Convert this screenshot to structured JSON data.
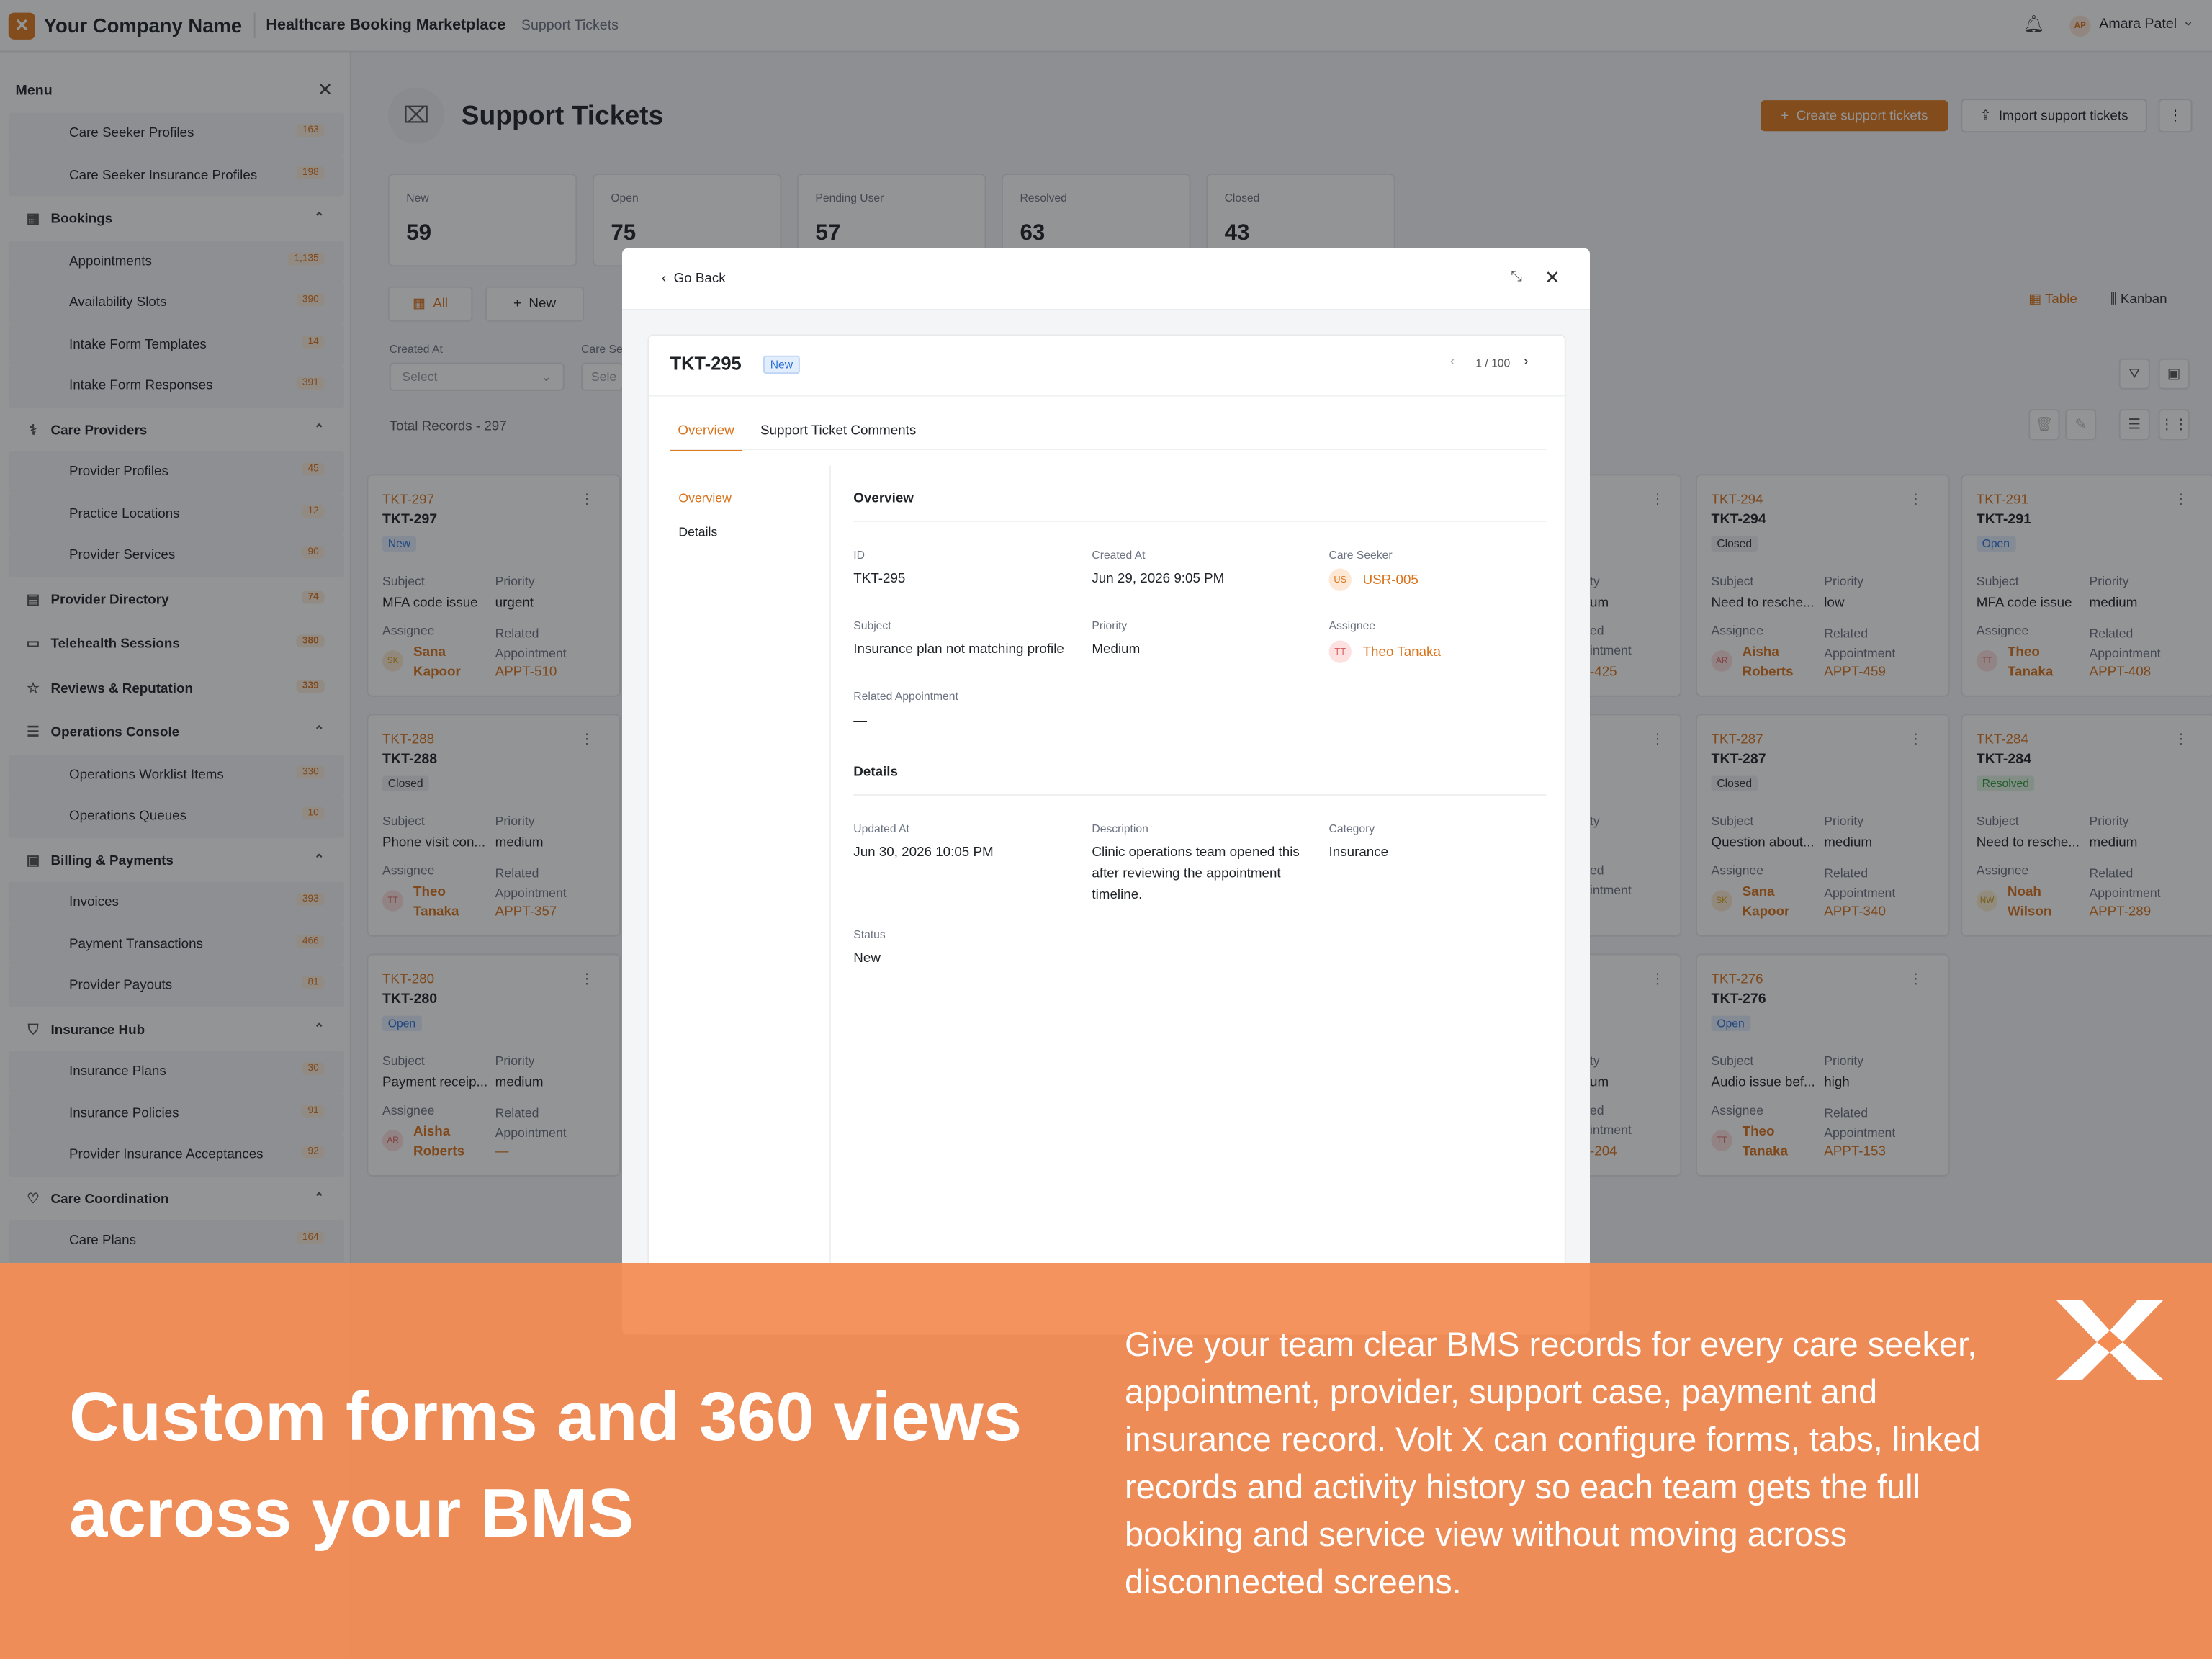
{
  "header": {
    "logo_glyph": "✕",
    "company": "Your Company Name",
    "app_name": "Healthcare Booking Marketplace",
    "breadcrumb": "Support Tickets",
    "user_initials": "AP",
    "user_name": "Amara Patel"
  },
  "sidebar": {
    "title": "Menu",
    "items": [
      {
        "label": "Care Seeker Profiles",
        "badge": "163",
        "type": "child"
      },
      {
        "label": "Care Seeker Insurance Profiles",
        "badge": "198",
        "type": "child"
      },
      {
        "label": "Bookings",
        "type": "parent",
        "icon": "calendar-icon",
        "glyph": "▦"
      },
      {
        "label": "Appointments",
        "badge": "1,135",
        "type": "child"
      },
      {
        "label": "Availability Slots",
        "badge": "390",
        "type": "child"
      },
      {
        "label": "Intake Form Templates",
        "badge": "14",
        "type": "child"
      },
      {
        "label": "Intake Form Responses",
        "badge": "391",
        "type": "child"
      },
      {
        "label": "Care Providers",
        "type": "parent",
        "icon": "stethoscope-icon",
        "glyph": "⚕"
      },
      {
        "label": "Provider Profiles",
        "badge": "45",
        "type": "child"
      },
      {
        "label": "Practice Locations",
        "badge": "12",
        "type": "child"
      },
      {
        "label": "Provider Services",
        "badge": "90",
        "type": "child"
      },
      {
        "label": "Provider Directory",
        "badge": "74",
        "type": "leaf",
        "icon": "book-icon",
        "glyph": "▤"
      },
      {
        "label": "Telehealth Sessions",
        "badge": "380",
        "type": "leaf",
        "icon": "video-icon",
        "glyph": "▭"
      },
      {
        "label": "Reviews & Reputation",
        "badge": "339",
        "type": "leaf",
        "icon": "star-icon",
        "glyph": "☆"
      },
      {
        "label": "Operations Console",
        "type": "parent",
        "icon": "sliders-icon",
        "glyph": "☰"
      },
      {
        "label": "Operations Worklist Items",
        "badge": "330",
        "type": "child"
      },
      {
        "label": "Operations Queues",
        "badge": "10",
        "type": "child"
      },
      {
        "label": "Billing & Payments",
        "type": "parent",
        "icon": "receipt-icon",
        "glyph": "▣"
      },
      {
        "label": "Invoices",
        "badge": "393",
        "type": "child"
      },
      {
        "label": "Payment Transactions",
        "badge": "466",
        "type": "child"
      },
      {
        "label": "Provider Payouts",
        "badge": "81",
        "type": "child"
      },
      {
        "label": "Insurance Hub",
        "type": "parent",
        "icon": "shield-icon",
        "glyph": "⛉"
      },
      {
        "label": "Insurance Plans",
        "badge": "30",
        "type": "child"
      },
      {
        "label": "Insurance Policies",
        "badge": "91",
        "type": "child"
      },
      {
        "label": "Provider Insurance Acceptances",
        "badge": "92",
        "type": "child"
      },
      {
        "label": "Care Coordination",
        "type": "parent",
        "icon": "heart-icon",
        "glyph": "♡"
      },
      {
        "label": "Care Plans",
        "badge": "164",
        "type": "child"
      }
    ]
  },
  "page": {
    "title": "Support Tickets",
    "create_label": "Create support tickets",
    "import_label": "Import support tickets",
    "stats": [
      {
        "label": "New",
        "value": "59"
      },
      {
        "label": "Open",
        "value": "75"
      },
      {
        "label": "Pending User",
        "value": "57"
      },
      {
        "label": "Resolved",
        "value": "63"
      },
      {
        "label": "Closed",
        "value": "43"
      }
    ],
    "tab_all": "All",
    "tab_new": "New",
    "view_table": "Table",
    "view_kanban": "Kanban",
    "filter_label": "Created At",
    "filter_placeholder": "Select",
    "filter2_label": "Care Se",
    "filter2_placeholder": "Sele",
    "total_records": "Total Records - 297",
    "field_subject": "Subject",
    "field_priority": "Priority",
    "field_assignee": "Assignee",
    "field_related": "Related Appointment"
  },
  "cards": [
    {
      "id": "TKT-297",
      "title": "TKT-297",
      "status": "New",
      "subject": "MFA code issue",
      "priority": "urgent",
      "initials": "SK",
      "assignee": "Sana Kapoor",
      "related": "APPT-510"
    },
    {
      "id": "TKT-288",
      "title": "TKT-288",
      "status": "Closed",
      "subject": "Phone visit con...",
      "priority": "medium",
      "initials": "TT",
      "assignee": "Theo Tanaka",
      "related": "APPT-357"
    },
    {
      "id": "TKT-280",
      "title": "TKT-280",
      "status": "Open",
      "subject": "Payment receip...",
      "priority": "medium",
      "initials": "AR",
      "assignee": "Aisha Roberts",
      "related": "—"
    },
    {
      "id": "TKT-294",
      "title": "TKT-294",
      "status": "Closed",
      "subject": "Need to resche...",
      "priority": "low",
      "initials": "AR",
      "assignee": "Aisha Roberts",
      "related": "APPT-459"
    },
    {
      "id": "TKT-287",
      "title": "TKT-287",
      "status": "Closed",
      "subject": "Question about...",
      "priority": "medium",
      "initials": "SK",
      "assignee": "Sana Kapoor",
      "related": "APPT-340"
    },
    {
      "id": "TKT-276",
      "title": "TKT-276",
      "status": "Open",
      "subject": "Audio issue bef...",
      "priority": "high",
      "initials": "TT",
      "assignee": "Theo Tanaka",
      "related": "APPT-153"
    },
    {
      "id": "TKT-291",
      "title": "TKT-291",
      "status": "Open",
      "subject": "MFA code issue",
      "priority": "medium",
      "initials": "TT",
      "assignee": "Theo Tanaka",
      "related": "APPT-408"
    },
    {
      "id": "TKT-284",
      "title": "TKT-284",
      "status": "Resolved",
      "subject": "Need to resche...",
      "priority": "medium",
      "initials": "NW",
      "assignee": "Noah Wilson",
      "related": "APPT-289"
    }
  ],
  "partial_cards": [
    {
      "a": "ty",
      "b": "um",
      "c": "ed",
      "d": "intment",
      "e": "-425"
    },
    {
      "a": "ty",
      "b": "",
      "c": "ed",
      "d": "intment",
      "e": ""
    },
    {
      "a": "ty",
      "b": "um",
      "c": "ed",
      "d": "intment",
      "e": "-204"
    }
  ],
  "modal": {
    "go_back": "Go Back",
    "ticket": "TKT-295",
    "status": "New",
    "pager": "1 / 100",
    "tab_overview": "Overview",
    "tab_comments": "Support Ticket Comments",
    "nav_overview": "Overview",
    "nav_details": "Details",
    "overview_title": "Overview",
    "details_title": "Details",
    "id_label": "ID",
    "id_value": "TKT-295",
    "created_label": "Created At",
    "created_value": "Jun 29, 2026 9:05 PM",
    "seeker_label": "Care Seeker",
    "seeker_initials": "US",
    "seeker_value": "USR-005",
    "subject_label": "Subject",
    "subject_value": "Insurance plan not matching profile",
    "priority_label": "Priority",
    "priority_value": "Medium",
    "assignee_label": "Assignee",
    "assignee_initials": "TT",
    "assignee_value": "Theo Tanaka",
    "related_label": "Related Appointment",
    "related_value": "—",
    "updated_label": "Updated At",
    "updated_value": "Jun 30, 2026 10:05 PM",
    "desc_label": "Description",
    "desc_value": "Clinic operations team opened this after reviewing the appointment timeline.",
    "category_label": "Category",
    "category_value": "Insurance",
    "status_label": "Status",
    "status_value": "New"
  },
  "banner": {
    "headline": "Custom forms and 360 views across your BMS",
    "body": "Give your team clear BMS records for every care seeker, appointment, provider, support case, payment and insurance record. Volt X can configure forms, tabs, linked records and activity history so each team gets the full booking and service view without moving across disconnected screens."
  },
  "colors": {
    "accent": "#e07a1f",
    "banner": "#f48c54"
  }
}
